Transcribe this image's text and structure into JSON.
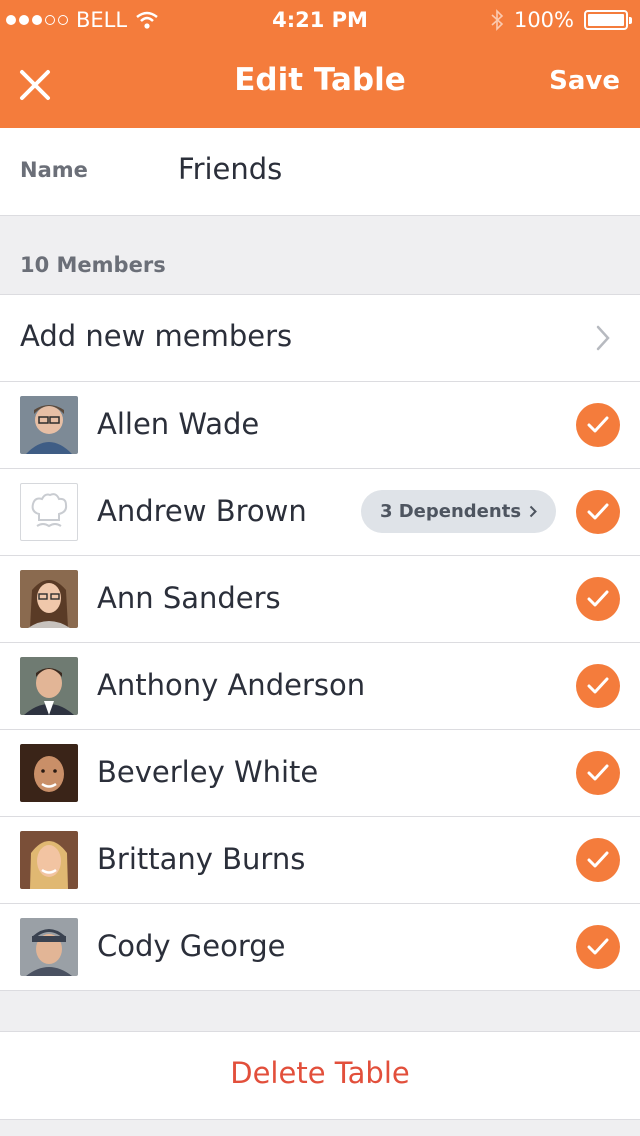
{
  "status_bar": {
    "carrier": "BELL",
    "time": "4:21 PM",
    "battery": "100%",
    "battery_level": 1.0,
    "signal_strength": 3,
    "signal_max": 5,
    "icons": [
      "wifi-icon",
      "bluetooth-icon",
      "battery-icon"
    ]
  },
  "nav": {
    "title": "Edit Table",
    "save_label": "Save",
    "close_icon": "close-icon"
  },
  "form": {
    "name_label": "Name",
    "name_value": "Friends"
  },
  "members": {
    "header": "10 Members",
    "add_label": "Add new members",
    "list": [
      {
        "name": "Allen Wade",
        "selected": true
      },
      {
        "name": "Andrew Brown",
        "selected": true,
        "badge": "3 Dependents"
      },
      {
        "name": "Ann Sanders",
        "selected": true
      },
      {
        "name": "Anthony Anderson",
        "selected": true
      },
      {
        "name": "Beverley White",
        "selected": true
      },
      {
        "name": "Brittany Burns",
        "selected": true
      },
      {
        "name": "Cody George",
        "selected": true
      }
    ]
  },
  "actions": {
    "delete_label": "Delete Table"
  },
  "colors": {
    "accent": "#f47c3c",
    "danger": "#e24f3b",
    "background": "#efeff1"
  }
}
